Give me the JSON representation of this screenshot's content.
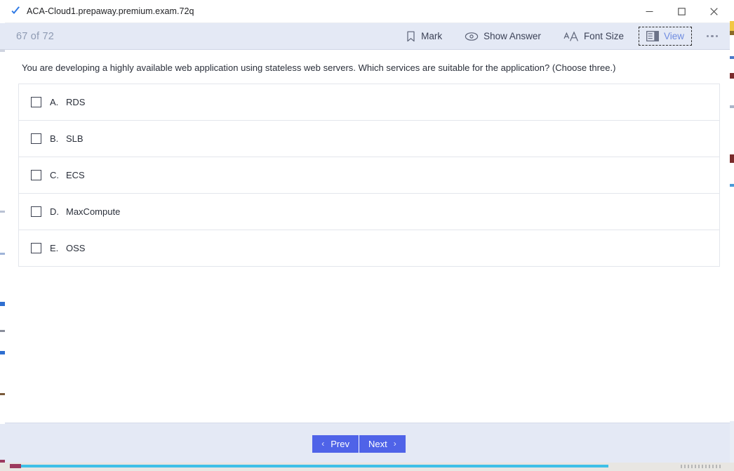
{
  "window": {
    "title": "ACA-Cloud1.prepaway.premium.exam.72q",
    "app_icon": "blue-check-icon",
    "controls": {
      "minimize": "minimize-icon",
      "maximize": "maximize-icon",
      "close": "close-icon"
    }
  },
  "toolbar": {
    "counter": "67 of 72",
    "items": [
      {
        "label": "Mark",
        "icon": "bookmark-icon",
        "focused": false
      },
      {
        "label": "Show Answer",
        "icon": "eye-icon",
        "focused": false
      },
      {
        "label": "Font Size",
        "icon": "font-size-icon",
        "focused": false
      },
      {
        "label": "View",
        "icon": "layout-panel-icon",
        "focused": true
      }
    ],
    "more_label": "more-options-icon"
  },
  "question": {
    "text": "You are developing a highly available web application using stateless web servers. Which services are suitable for the application? (Choose three.)",
    "options": [
      {
        "letter": "A.",
        "label": "RDS",
        "checked": false
      },
      {
        "letter": "B.",
        "label": "SLB",
        "checked": false
      },
      {
        "letter": "C.",
        "label": "ECS",
        "checked": false
      },
      {
        "letter": "D.",
        "label": "MaxCompute",
        "checked": false
      },
      {
        "letter": "E.",
        "label": "OSS",
        "checked": false
      }
    ]
  },
  "footer": {
    "prev_label": "Prev",
    "next_label": "Next",
    "prev_chevron": "‹",
    "next_chevron": "›"
  },
  "colors": {
    "toolbar_bg": "#e4e9f5",
    "accent_blue": "#4f63e8",
    "view_active": "#6f8ce0",
    "counter_text": "#8f9bb3"
  }
}
